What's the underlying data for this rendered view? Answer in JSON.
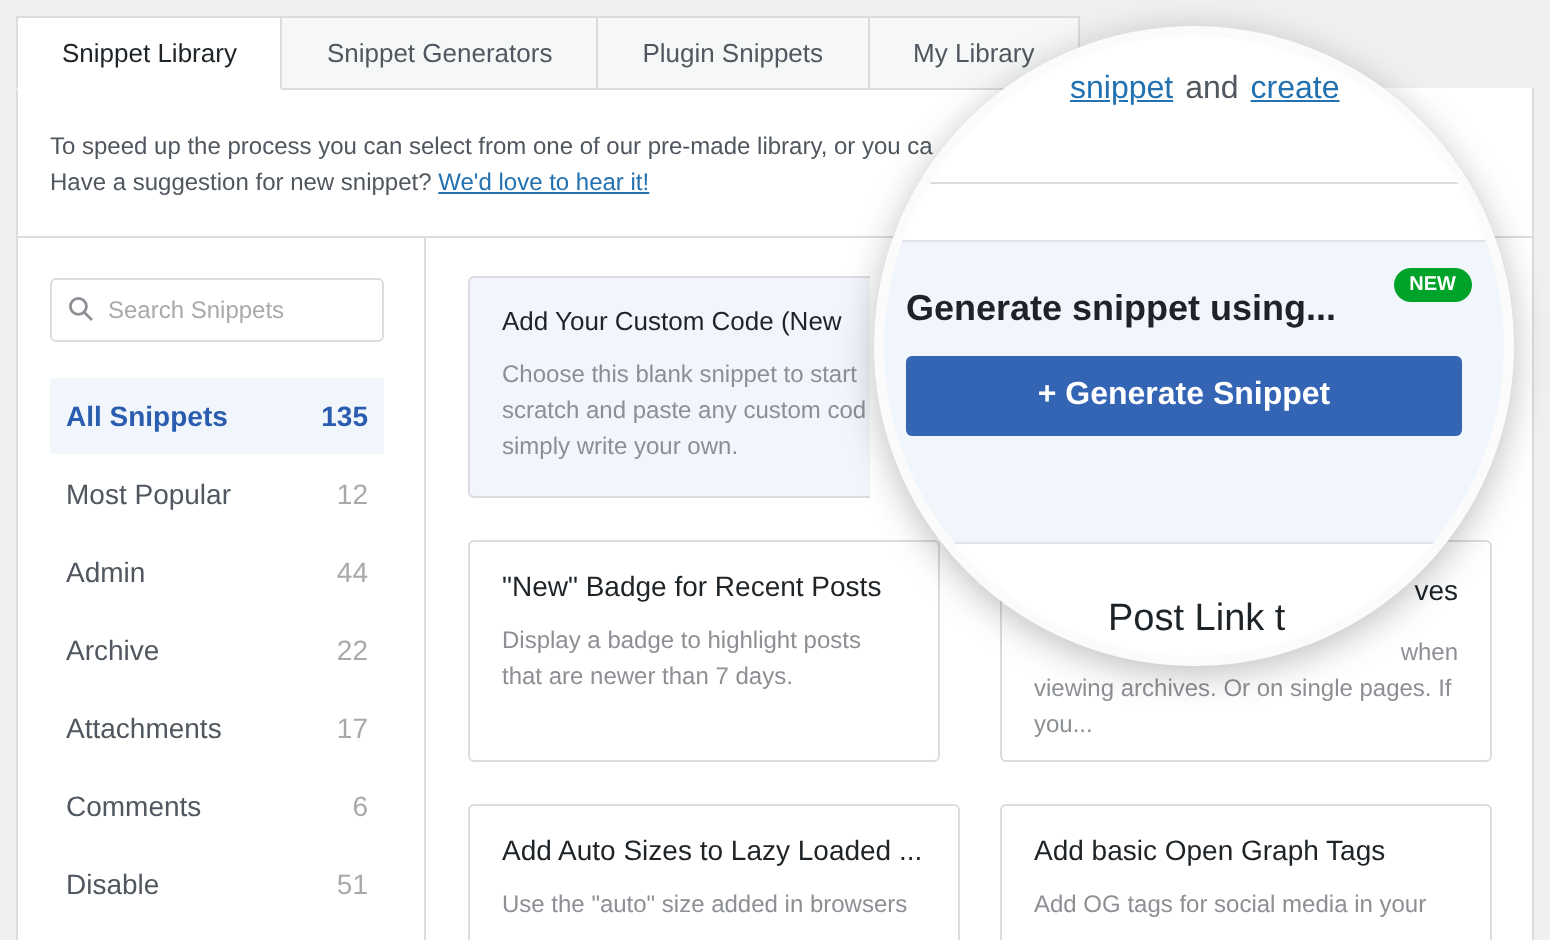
{
  "tabs": [
    {
      "label": "Snippet Library",
      "selected": true
    },
    {
      "label": "Snippet Generators",
      "selected": false
    },
    {
      "label": "Plugin Snippets",
      "selected": false
    },
    {
      "label": "My Library",
      "selected": false
    }
  ],
  "intro": {
    "line_1": "To speed up the process you can select from one of our pre-made library, or you ca",
    "line_2": "Have a suggestion for new snippet?",
    "link": "We'd love to hear it!"
  },
  "search": {
    "placeholder": "Search Snippets"
  },
  "categories": [
    {
      "label": "All Snippets",
      "count": "135",
      "selected": true
    },
    {
      "label": "Most Popular",
      "count": "12",
      "selected": false
    },
    {
      "label": "Admin",
      "count": "44",
      "selected": false
    },
    {
      "label": "Archive",
      "count": "22",
      "selected": false
    },
    {
      "label": "Attachments",
      "count": "17",
      "selected": false
    },
    {
      "label": "Comments",
      "count": "6",
      "selected": false
    },
    {
      "label": "Disable",
      "count": "51",
      "selected": false
    }
  ],
  "cards": [
    {
      "kind": "featured",
      "title": "Add Your Custom Code (New",
      "lines": [
        "Choose this blank snippet to start",
        "scratch and paste any custom cod",
        "simply write your own."
      ]
    },
    {
      "kind": "hidden"
    },
    {
      "kind": "normal",
      "title": "\"New\" Badge for Recent Posts",
      "description": "Display a badge to highlight posts that are newer than 7 days."
    },
    {
      "kind": "partial",
      "title": "ves",
      "description_top": "when",
      "description": "viewing archives. Or on single pages. If you..."
    },
    {
      "kind": "normal",
      "title": "Add Auto Sizes to Lazy Loaded ...",
      "description": "Use the \"auto\" size added in browsers"
    },
    {
      "kind": "normal",
      "title": "Add basic Open Graph Tags",
      "description": "Add OG tags for social media in your"
    }
  ],
  "magnifier": {
    "link_1": "snippet",
    "joiner": "and",
    "link_2": "create",
    "heading": "Generate snippet using...",
    "badge": "NEW",
    "button": "+ Generate Snippet",
    "fragment": "Post Link t"
  }
}
